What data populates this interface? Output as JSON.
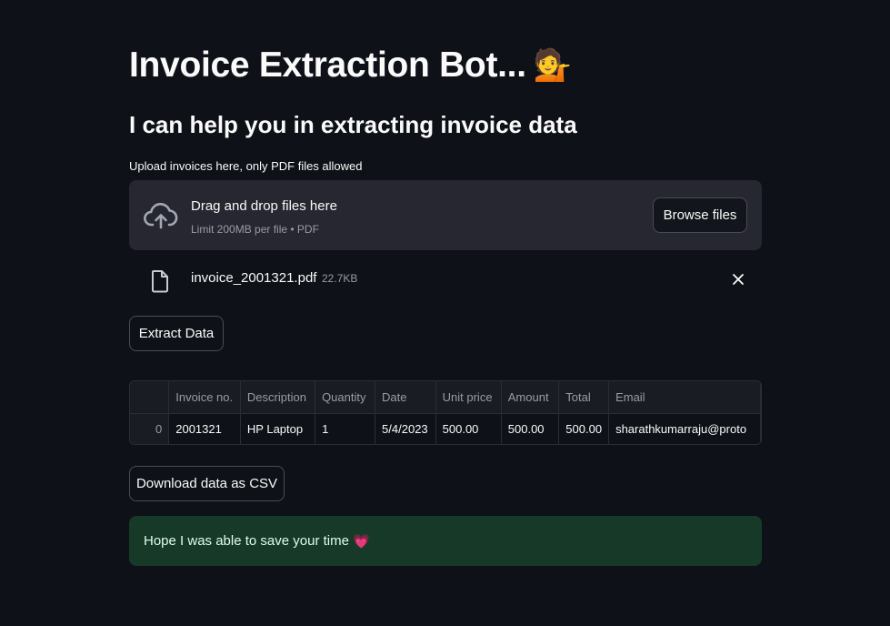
{
  "header": {
    "title": "Invoice Extraction Bot...",
    "title_emoji": "💁",
    "subtitle": "I can help you in extracting invoice data"
  },
  "uploader": {
    "label": "Upload invoices here, only PDF files allowed",
    "drop_title": "Drag and drop files here",
    "drop_subtitle": "Limit 200MB per file • PDF",
    "browse_label": "Browse files",
    "icon": "cloud-upload-icon"
  },
  "uploaded_file": {
    "name": "invoice_2001321.pdf",
    "size": "22.7KB",
    "icon": "file-icon"
  },
  "actions": {
    "extract_label": "Extract Data",
    "download_label": "Download data as CSV"
  },
  "table": {
    "columns": [
      "",
      "Invoice no.",
      "Description",
      "Quantity",
      "Date",
      "Unit price",
      "Amount",
      "Total",
      "Email"
    ],
    "rows": [
      [
        "0",
        "2001321",
        "HP Laptop",
        "1",
        "5/4/2023",
        "500.00",
        "500.00",
        "500.00",
        "sharathkumarraju@proto"
      ]
    ]
  },
  "success": {
    "message": "Hope I was able to save your time",
    "emoji": "💗"
  },
  "colors": {
    "background": "#0e1117",
    "dropzone": "#262730",
    "success_bg": "#173928"
  }
}
